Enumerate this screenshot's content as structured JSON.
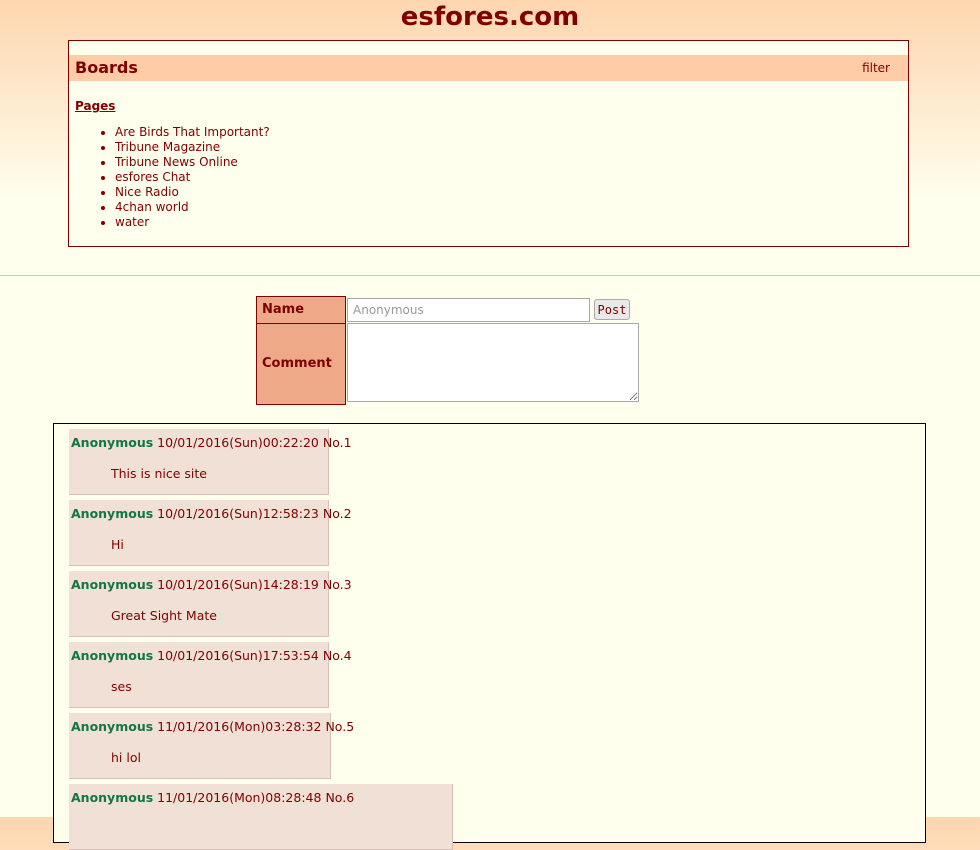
{
  "site": {
    "title": "esfores.com"
  },
  "boards": {
    "title": "Boards",
    "filter_label": "filter",
    "pages_label": "Pages",
    "pages": [
      "Are Birds That Important?",
      "Tribune Magazine",
      "Tribune News Online",
      "esfores Chat",
      "Nice Radio",
      "4chan world",
      "water"
    ]
  },
  "form": {
    "name_label": "Name",
    "name_placeholder": "Anonymous",
    "post_button": "Post",
    "comment_label": "Comment"
  },
  "posts": [
    {
      "name": "Anonymous",
      "date": "10/01/2016(Sun)00:22:20",
      "no": "No.1",
      "message": "This is nice site"
    },
    {
      "name": "Anonymous",
      "date": "10/01/2016(Sun)12:58:23",
      "no": "No.2",
      "message": "Hi"
    },
    {
      "name": "Anonymous",
      "date": "10/01/2016(Sun)14:28:19",
      "no": "No.3",
      "message": "Great Sight Mate"
    },
    {
      "name": "Anonymous",
      "date": "10/01/2016(Sun)17:53:54",
      "no": "No.4",
      "message": "ses"
    },
    {
      "name": "Anonymous",
      "date": "11/01/2016(Mon)03:28:32",
      "no": "No.5",
      "message": "hi lol"
    },
    {
      "name": "Anonymous",
      "date": "11/01/2016(Mon)08:28:48",
      "no": "No.6",
      "message": ""
    }
  ],
  "colors": {
    "accent": "#800000",
    "poster_name": "#117743",
    "reply_bg": "#f0e0d6",
    "header_bg": "#fecca6",
    "form_label_bg": "#eeaa88"
  }
}
